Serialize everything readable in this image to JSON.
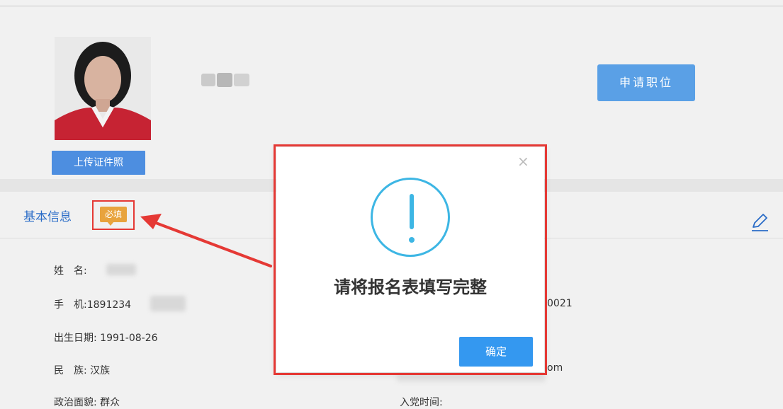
{
  "header": {
    "upload_photo_label": "上传证件照",
    "apply_position_label": "申请职位"
  },
  "section": {
    "title": "基本信息",
    "required_badge": "必填"
  },
  "fields": {
    "name_label": "姓　名:",
    "phone_label": "手　机:",
    "phone_value": "1891234",
    "birth_label": "出生日期:",
    "birth_value": "1991-08-26",
    "ethnicity_label": "民　族:",
    "ethnicity_value": "汉族",
    "politics_label": "政治面貌:",
    "politics_value": "群众",
    "right_col_fragment_1": "0021",
    "right_col_fragment_2": "om",
    "party_join_label": "入党时间:"
  },
  "modal": {
    "close_glyph": "×",
    "message": "请将报名表填写完整",
    "confirm_label": "确定"
  },
  "colors": {
    "accent_blue": "#4d8ee0",
    "alert_cyan": "#3db6e4",
    "badge_orange": "#e8a33d",
    "annotation_red": "#e53935"
  },
  "icons": {
    "edit": "pencil-icon",
    "alert": "exclamation-circle-icon",
    "close": "close-icon"
  }
}
